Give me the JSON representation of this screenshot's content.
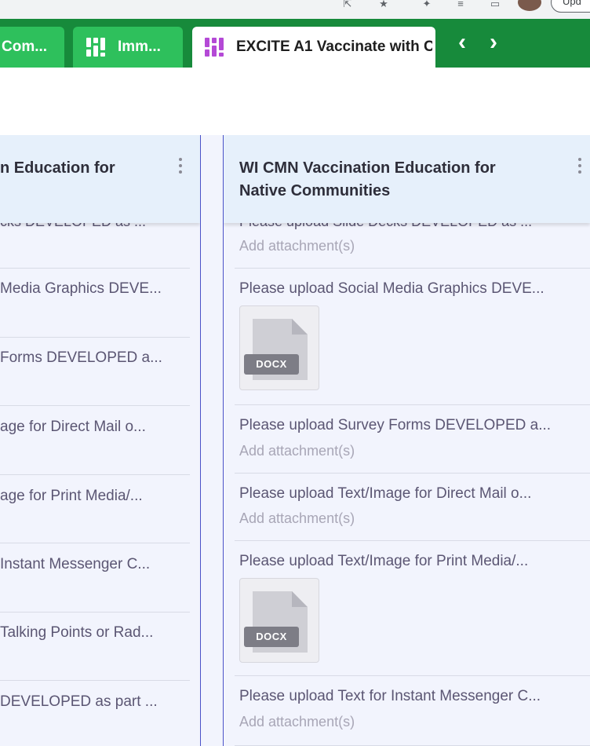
{
  "browser": {
    "update_label": "Upd"
  },
  "tabs": [
    {
      "label": "Com...",
      "icon": "app-grid-icon",
      "active": false
    },
    {
      "label": "Imm...",
      "icon": "app-grid-icon",
      "active": false
    },
    {
      "label": "EXCITE A1 Vaccinate with C",
      "icon": "app-grid-icon",
      "active": true
    }
  ],
  "colors": {
    "tabbar": "#178a3b",
    "tab_inactive": "#2ec05c",
    "active_icon": "#b449d6",
    "board_bg": "#f2f4fd",
    "header_bg": "#e6f0fb",
    "divider": "#4a52c8"
  },
  "left_column": {
    "title": "n Education for",
    "cut_top": "cks DEVELOPED as ...",
    "rows": [
      {
        "title": "Media Graphics DEVE..."
      },
      {
        "title": "Forms DEVELOPED a..."
      },
      {
        "title": "age for Direct Mail o..."
      },
      {
        "title": "age for Print Media/..."
      },
      {
        "title": " Instant Messenger C..."
      },
      {
        "title": " Talking Points or Rad..."
      },
      {
        "title": "DEVELOPED as part ..."
      }
    ]
  },
  "right_column": {
    "title_line1": "WI CMN Vaccination Education for",
    "title_line2": "Native Communities",
    "cut_top": "Please upload Slide Decks DEVELOPED as ...",
    "cut_top_add": "Add attachment(s)",
    "rows": [
      {
        "title": "Please upload Social Media Graphics DEVE...",
        "attachment": "DOCX"
      },
      {
        "title": "Please upload Survey Forms DEVELOPED a...",
        "add": "Add attachment(s)"
      },
      {
        "title": "Please upload Text/Image for Direct Mail o...",
        "add": "Add attachment(s)"
      },
      {
        "title": "Please upload Text/Image for Print Media/...",
        "attachment": "DOCX"
      },
      {
        "title": "Please upload Text for Instant Messenger C...",
        "add": "Add attachment(s)"
      }
    ]
  }
}
